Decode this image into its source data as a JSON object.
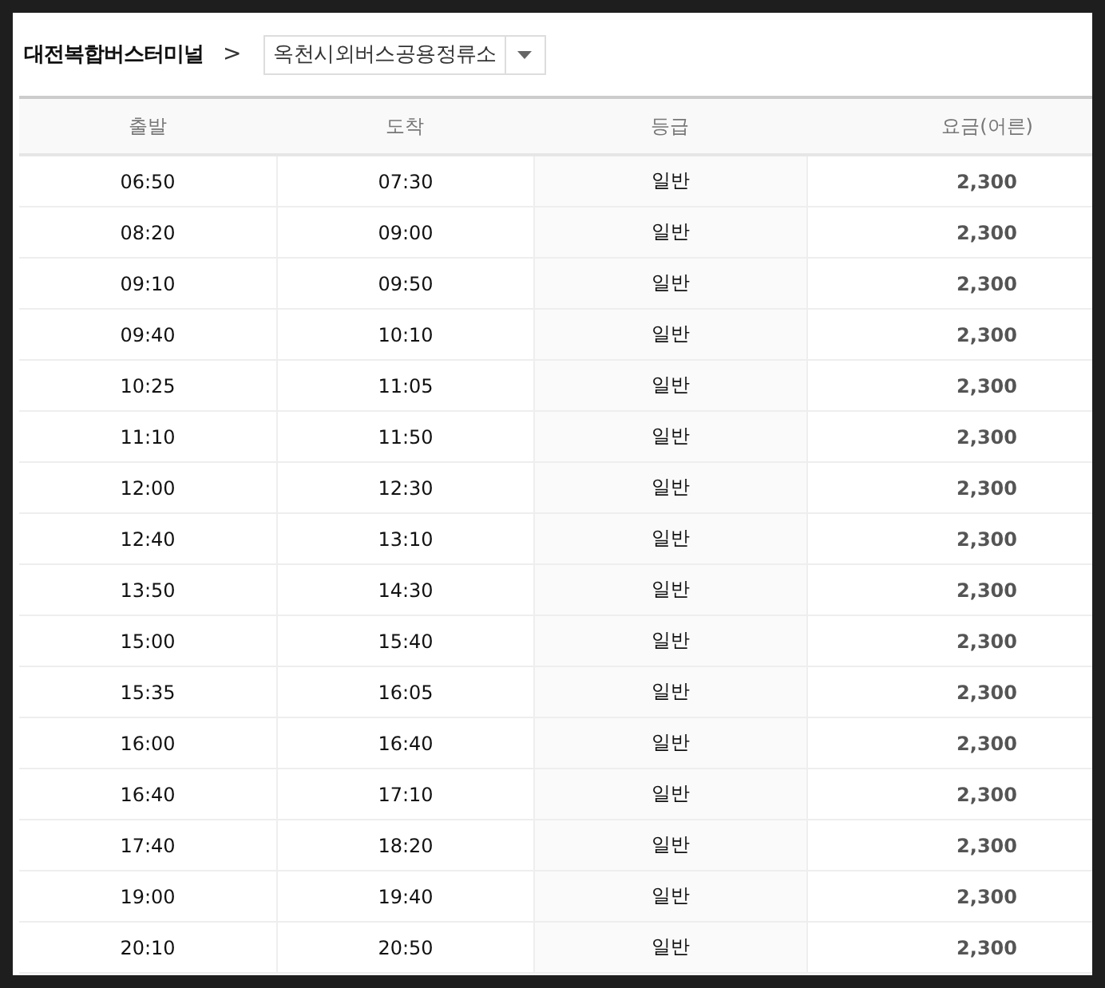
{
  "header": {
    "origin": "대전복합버스터미널",
    "separator": ">",
    "destination": {
      "value": "옥천시외버스공용정류소"
    }
  },
  "table": {
    "columns": [
      "출발",
      "도착",
      "등급",
      "요금(어른)"
    ],
    "rows": [
      [
        "06:50",
        "07:30",
        "일반",
        "2,300"
      ],
      [
        "08:20",
        "09:00",
        "일반",
        "2,300"
      ],
      [
        "09:10",
        "09:50",
        "일반",
        "2,300"
      ],
      [
        "09:40",
        "10:10",
        "일반",
        "2,300"
      ],
      [
        "10:25",
        "11:05",
        "일반",
        "2,300"
      ],
      [
        "11:10",
        "11:50",
        "일반",
        "2,300"
      ],
      [
        "12:00",
        "12:30",
        "일반",
        "2,300"
      ],
      [
        "12:40",
        "13:10",
        "일반",
        "2,300"
      ],
      [
        "13:50",
        "14:30",
        "일반",
        "2,300"
      ],
      [
        "15:00",
        "15:40",
        "일반",
        "2,300"
      ],
      [
        "15:35",
        "16:05",
        "일반",
        "2,300"
      ],
      [
        "16:00",
        "16:40",
        "일반",
        "2,300"
      ],
      [
        "16:40",
        "17:10",
        "일반",
        "2,300"
      ],
      [
        "17:40",
        "18:20",
        "일반",
        "2,300"
      ],
      [
        "19:00",
        "19:40",
        "일반",
        "2,300"
      ],
      [
        "20:10",
        "20:50",
        "일반",
        "2,300"
      ]
    ]
  }
}
